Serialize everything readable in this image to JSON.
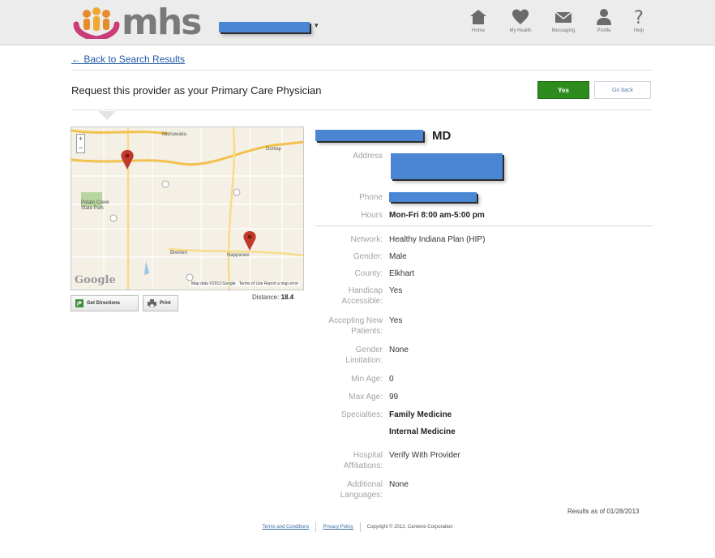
{
  "header": {
    "logo_text": "mhs",
    "nav": [
      {
        "label": "Home",
        "icon": "home-icon"
      },
      {
        "label": "My Health",
        "icon": "heart-icon"
      },
      {
        "label": "Messaging",
        "icon": "envelope-icon"
      },
      {
        "label": "Profile",
        "icon": "person-icon"
      },
      {
        "label": "Help",
        "icon": "question-icon"
      }
    ]
  },
  "back_link": "← Back to Search Results",
  "request": {
    "text": "Request this provider as your Primary Care Physician",
    "yes_label": "Yes",
    "go_back_label": "Go back"
  },
  "map": {
    "labels": [
      "Mishawaka",
      "Dunlap",
      "Potato Creek State Park",
      "Bremen",
      "Nappanee"
    ],
    "google": "Google",
    "footer": "Map data ©2013 Google · Terms of Use  Report a map error",
    "get_directions": "Get Directions",
    "print": "Print",
    "distance_label": "Distance:",
    "distance_value": "18.4"
  },
  "provider": {
    "suffix": "MD",
    "address_label": "Address",
    "phone_label": "Phone",
    "hours_label": "Hours",
    "hours": "Mon-Fri 8:00 am-5:00 pm",
    "fields": [
      {
        "label": "Network:",
        "value": "Healthy Indiana Plan (HIP)"
      },
      {
        "label": "Gender:",
        "value": "Male"
      },
      {
        "label": "County:",
        "value": "Elkhart"
      },
      {
        "label": "Handicap Accessible:",
        "value": "Yes"
      },
      {
        "label": "Accepting New Patients:",
        "value": "Yes"
      },
      {
        "label": "Gender Limitation:",
        "value": "None"
      },
      {
        "label": "Min Age:",
        "value": "0"
      },
      {
        "label": "Max Age:",
        "value": "99"
      },
      {
        "label": "Specialties:",
        "value": "Family Medicine"
      },
      {
        "label": "",
        "value": "Internal Medicine"
      },
      {
        "label": "Hospital Affiliations:",
        "value": "Verify With Provider"
      },
      {
        "label": "Additional Languages:",
        "value": "None"
      }
    ]
  },
  "results_as_of": "Results as of 01/28/2013",
  "footer": {
    "terms": "Terms and Conditions",
    "privacy": "Privacy Policy",
    "copyright": "Copyright © 2012, Centene Corporation"
  },
  "colors": {
    "yes_button": "#2e8b1e",
    "redaction": "#4a86d4",
    "link": "#1f5aa6"
  }
}
